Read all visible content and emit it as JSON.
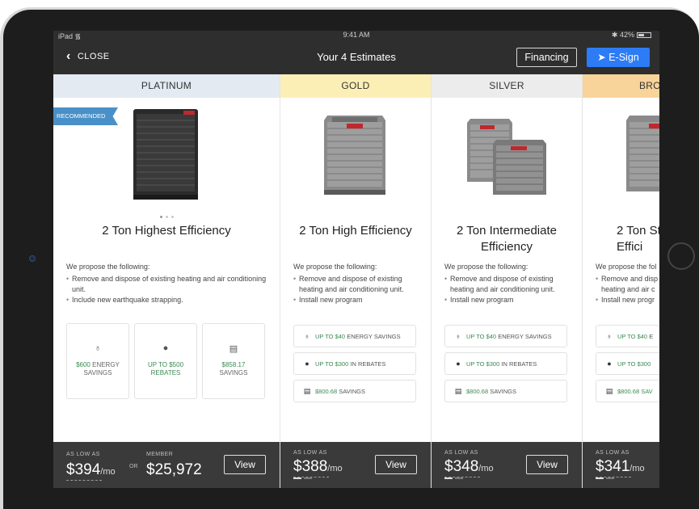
{
  "status_bar": {
    "device": "iPad",
    "time": "9:41 AM",
    "battery": "42%"
  },
  "nav": {
    "close_label": "CLOSE",
    "title": "Your 4 Estimates",
    "financing_label": "Financing",
    "esign_label": "E-Sign"
  },
  "colors": {
    "platinum_header": "#e3eaf1",
    "gold_header": "#fcefb5",
    "silver_header": "#ececec",
    "bronze_header": "#f8d39a",
    "esign_blue": "#2d7cf6",
    "savings_green": "#3a8a52",
    "ribbon_blue": "#4a90c8"
  },
  "cards": [
    {
      "tier": "PLATINUM",
      "ribbon": "RECOMMENDED",
      "name": "2 Ton Highest Efficiency",
      "proposal_lead": "We propose the following:",
      "bullets": [
        "Remove and dispose of existing heating and air conditioning unit.",
        "Include new earthquake strapping."
      ],
      "metrics": [
        {
          "icon": "lightbulb-icon",
          "value": "$600",
          "suffix": "ENERGY",
          "line2": "SAVINGS"
        },
        {
          "icon": "dollar-coin-icon",
          "value": "UP TO $500",
          "suffix": "",
          "line2": "REBATES"
        },
        {
          "icon": "receipt-icon",
          "value": "$858.17",
          "suffix": "",
          "line2": "SAVINGS"
        }
      ],
      "footer": {
        "as_low_as": "AS LOW AS",
        "price": "$394",
        "per": "/mo",
        "or": "OR",
        "member_label": "MEMBER",
        "member_price": "$25,972",
        "view": "View"
      }
    },
    {
      "tier": "GOLD",
      "name": "2 Ton High Efficiency",
      "proposal_lead": "We propose the following:",
      "bullets": [
        "Remove and dispose of existing heating and air conditioning unit.",
        "Install new program"
      ],
      "pills": [
        {
          "icon": "lightbulb-icon",
          "green": "UP TO $40",
          "rest": "ENERGY SAVINGS"
        },
        {
          "icon": "dollar-coin-icon",
          "green": "UP TO $300",
          "rest": "IN REBATES"
        },
        {
          "icon": "receipt-icon",
          "green": "$800.68",
          "rest": "SAVINGS"
        }
      ],
      "footer": {
        "as_low_as": "AS LOW AS",
        "price": "$388",
        "per": "/mo",
        "view": "View"
      }
    },
    {
      "tier": "SILVER",
      "name": "2 Ton Intermediate Efficiency",
      "proposal_lead": "We propose the following:",
      "bullets": [
        "Remove and dispose of existing heating and air conditioning unit.",
        "Install new program"
      ],
      "pills": [
        {
          "icon": "lightbulb-icon",
          "green": "UP TO $40",
          "rest": "ENERGY SAVINGS"
        },
        {
          "icon": "dollar-coin-icon",
          "green": "UP TO $300",
          "rest": "IN REBATES"
        },
        {
          "icon": "receipt-icon",
          "green": "$800.68",
          "rest": "SAVINGS"
        }
      ],
      "footer": {
        "as_low_as": "AS LOW AS",
        "price": "$348",
        "per": "/mo",
        "view": "View"
      }
    },
    {
      "tier": "BRO",
      "name": "2 Ton St Effici",
      "proposal_lead": "We propose the fol",
      "bullets": [
        "Remove and disp heating and air c",
        "Install new progr"
      ],
      "pills": [
        {
          "icon": "lightbulb-icon",
          "green": "UP TO $40",
          "rest": "E"
        },
        {
          "icon": "dollar-coin-icon",
          "green": "UP TO $300",
          "rest": ""
        },
        {
          "icon": "receipt-icon",
          "green": "$800.68 SAV",
          "rest": ""
        }
      ],
      "footer": {
        "as_low_as": "AS LOW AS",
        "price": "$341",
        "per": "/mo"
      }
    }
  ]
}
